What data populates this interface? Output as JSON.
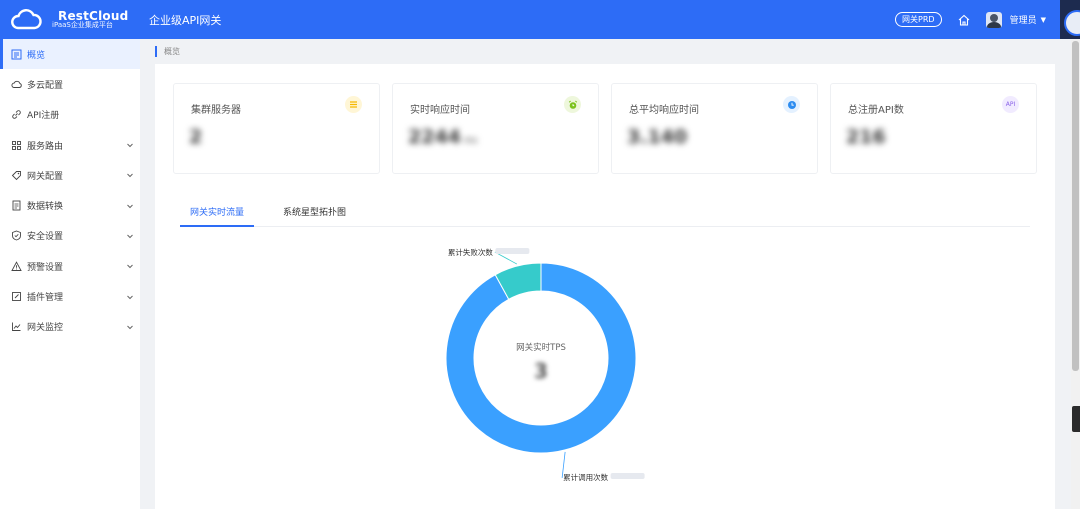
{
  "header": {
    "logo_title": "RestCloud",
    "logo_subtitle": "iPaaS企业集成平台",
    "app_title": "企业级API网关",
    "env_badge": "网关PRD",
    "user_name": "管理员",
    "icons": [
      "cloud-logo-icon",
      "home-icon",
      "avatar",
      "caret-down-icon"
    ]
  },
  "sidebar": {
    "items": [
      {
        "label": "概览",
        "icon": "dashboard-icon",
        "active": true,
        "expandable": false
      },
      {
        "label": "多云配置",
        "icon": "cloud-icon",
        "active": false,
        "expandable": false
      },
      {
        "label": "API注册",
        "icon": "link-icon",
        "active": false,
        "expandable": false
      },
      {
        "label": "服务路由",
        "icon": "grid-icon",
        "active": false,
        "expandable": true
      },
      {
        "label": "网关配置",
        "icon": "tag-icon",
        "active": false,
        "expandable": true
      },
      {
        "label": "数据转换",
        "icon": "document-icon",
        "active": false,
        "expandable": true
      },
      {
        "label": "安全设置",
        "icon": "shield-icon",
        "active": false,
        "expandable": true
      },
      {
        "label": "预警设置",
        "icon": "warning-icon",
        "active": false,
        "expandable": true
      },
      {
        "label": "插件管理",
        "icon": "edit-icon",
        "active": false,
        "expandable": true
      },
      {
        "label": "网关监控",
        "icon": "line-chart-icon",
        "active": false,
        "expandable": true
      }
    ]
  },
  "breadcrumb": {
    "label": "概览"
  },
  "cards": [
    {
      "title": "集群服务器",
      "value": "2",
      "unit": "",
      "icon": "list-icon",
      "icon_text": "",
      "icon_bg": "#fff6d6",
      "icon_color": "#f5b800"
    },
    {
      "title": "实时响应时间",
      "value": "2244",
      "unit": "ms",
      "icon": "alarm-clock-icon",
      "icon_text": "",
      "icon_bg": "#eef7dc",
      "icon_color": "#7cc21d"
    },
    {
      "title": "总平均响应时间",
      "value": "3.140",
      "unit": "",
      "icon": "clock-icon",
      "icon_text": "",
      "icon_bg": "#e4f1ff",
      "icon_color": "#2d8cf0"
    },
    {
      "title": "总注册API数",
      "value": "216",
      "unit": "",
      "icon": "api-icon",
      "icon_text": "API",
      "icon_bg": "#f1ebff",
      "icon_color": "#8a63e8"
    }
  ],
  "tabs": [
    {
      "label": "网关实时流量",
      "active": true
    },
    {
      "label": "系统星型拓扑图",
      "active": false
    }
  ],
  "chart_data": {
    "type": "pie",
    "title": "网关实时TPS",
    "center_value": "3",
    "slices": [
      {
        "name": "累计调用次数",
        "value": 92,
        "color": "#3aa0ff"
      },
      {
        "name": "累计失败次数",
        "value": 8,
        "color": "#36cbcb"
      }
    ]
  }
}
